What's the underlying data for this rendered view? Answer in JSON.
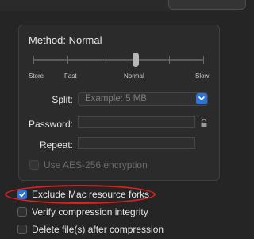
{
  "compression": {
    "method_title": "Method: Normal",
    "level": "Normal",
    "ticks": [
      "Store",
      "Fast",
      "Normal",
      "Slow"
    ]
  },
  "form": {
    "split_label": "Split:",
    "split_placeholder": "Example: 5 MB",
    "password_label": "Password:",
    "repeat_label": "Repeat:",
    "aes_label": "Use AES-256 encryption"
  },
  "options": [
    {
      "label": "Exclude Mac resource forks",
      "checked": true
    },
    {
      "label": "Verify compression integrity",
      "checked": false
    },
    {
      "label": "Delete file(s) after compression",
      "checked": false
    }
  ],
  "colors": {
    "accent": "#2f72d8",
    "highlight": "#e0201f",
    "background": "#252525"
  },
  "icons": {
    "select_arrow": "chevron-down-icon",
    "password_lock": "lock-icon",
    "check": "checkmark-icon"
  }
}
